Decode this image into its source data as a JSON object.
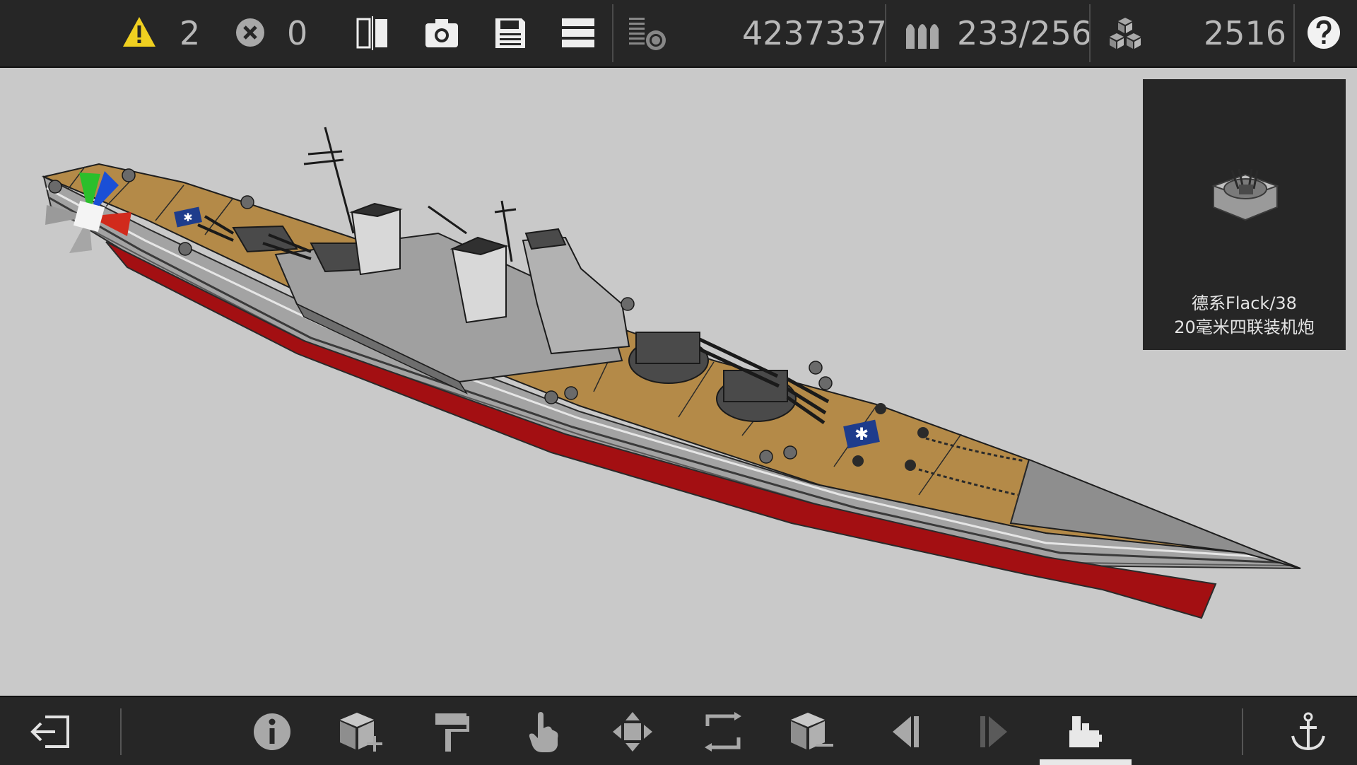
{
  "topbar": {
    "warnings": {
      "icon": "warning-icon",
      "count": "2",
      "color": "#f0d020"
    },
    "errors": {
      "icon": "error-x-icon",
      "count": "0"
    },
    "tools": [
      "mirror-icon",
      "camera-icon",
      "save-icon",
      "menu-icon",
      "layers-icon"
    ],
    "cost": "4237337",
    "ammo": {
      "icon": "ammo-icon",
      "value": "233/256"
    },
    "blocks": {
      "icon": "blocks-icon",
      "value": "2516"
    },
    "help": {
      "icon": "help-icon"
    }
  },
  "viewport": {
    "gizmo": {
      "icon": "axis-gizmo-icon",
      "colors": {
        "x": "#d12a1c",
        "y": "#2bbf2b",
        "z": "#1a4fd6"
      }
    },
    "ship": {
      "deck_color": "#b48a48",
      "hull_color": "#a3a3a3",
      "keel_color": "#a30f12"
    }
  },
  "selected_part": {
    "icon": "aa-gun-turret-icon",
    "name_line1": "德系Flack/38",
    "name_line2": "20毫米四联装机炮"
  },
  "bottombar": {
    "tools": [
      "exit-icon",
      "info-icon",
      "add-block-icon",
      "paint-icon",
      "select-hand-icon",
      "move-icon",
      "rotate-icon",
      "remove-block-icon",
      "prev-icon",
      "next-icon",
      "parts-icon",
      "anchor-icon"
    ],
    "active_tool": "parts-icon"
  }
}
